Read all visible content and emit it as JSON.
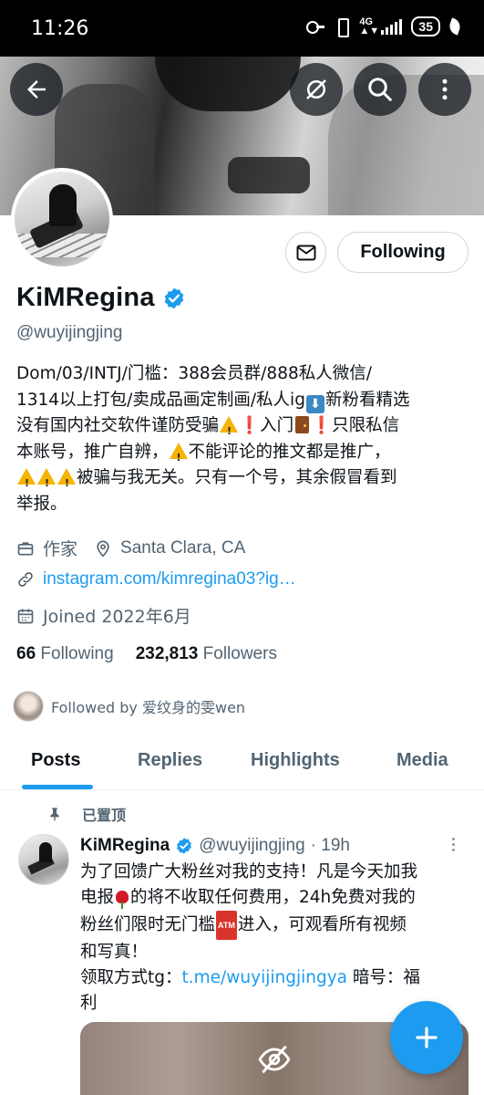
{
  "status_bar": {
    "time": "11:26",
    "battery": "35"
  },
  "profile": {
    "name": "KiMRegina",
    "handle": "@wuyijingjing",
    "follow_state": "Following",
    "bio": {
      "line1": "Dom/03/INTJ/门槛：388会员群/888私人微信/",
      "line2a": "1314以上打包/卖成品画定制画/私人ig",
      "line2b": "新粉看精选",
      "line3a": "没有国内社交软件谨防受骗",
      "line3b": "入门",
      "line3c": "只限私信",
      "line4a": "本账号，推广自辨，",
      "line4b": "不能评论的推文都是推广，",
      "line5": "被骗与我无关。只有一个号，其余假冒看到",
      "line6": "举报。"
    },
    "profession": "作家",
    "location": "Santa Clara, CA",
    "website": "instagram.com/kimregina03?ig…",
    "joined": "Joined 2022年6月",
    "following_count": "66",
    "following_label": "Following",
    "followers_count": "232,813",
    "followers_label": "Followers",
    "followed_by": "Followed by 爱纹身的雯wen"
  },
  "tabs": [
    {
      "label": "Posts",
      "active": true
    },
    {
      "label": "Replies",
      "active": false
    },
    {
      "label": "Highlights",
      "active": false
    },
    {
      "label": "Media",
      "active": false
    }
  ],
  "pinned_post": {
    "pinned_label": "已置顶",
    "author_name": "KiMRegina",
    "author_handle": "@wuyijingjing",
    "time": "· 19h",
    "text": {
      "line1": "为了回馈广大粉丝对我的支持！凡是今天加我",
      "line2a": "电报",
      "line2b": "的将不收取任何费用，24h免费对我的",
      "line3a": "粉丝们限时无门槛",
      "line3b": "进入，可观看所有视频",
      "line4": "和写真！",
      "line5a": "领取方式tg：",
      "line5_link": "t.me/wuyijingjingya",
      "line5b": " 暗号：福",
      "line6": "利"
    },
    "atm_label": "ATM"
  },
  "icons": {
    "back": "back-arrow-icon",
    "hide": "eye-slash-icon",
    "search": "search-icon",
    "more": "more-vertical-icon",
    "message": "envelope-icon",
    "verified": "verified-badge-icon",
    "profession": "briefcase-icon",
    "location": "location-pin-icon",
    "link": "link-icon",
    "calendar": "calendar-icon",
    "pin": "pin-icon",
    "compose": "plus-icon"
  },
  "colors": {
    "accent": "#1d9bf0",
    "text_primary": "#0f1419",
    "text_secondary": "#536471"
  }
}
